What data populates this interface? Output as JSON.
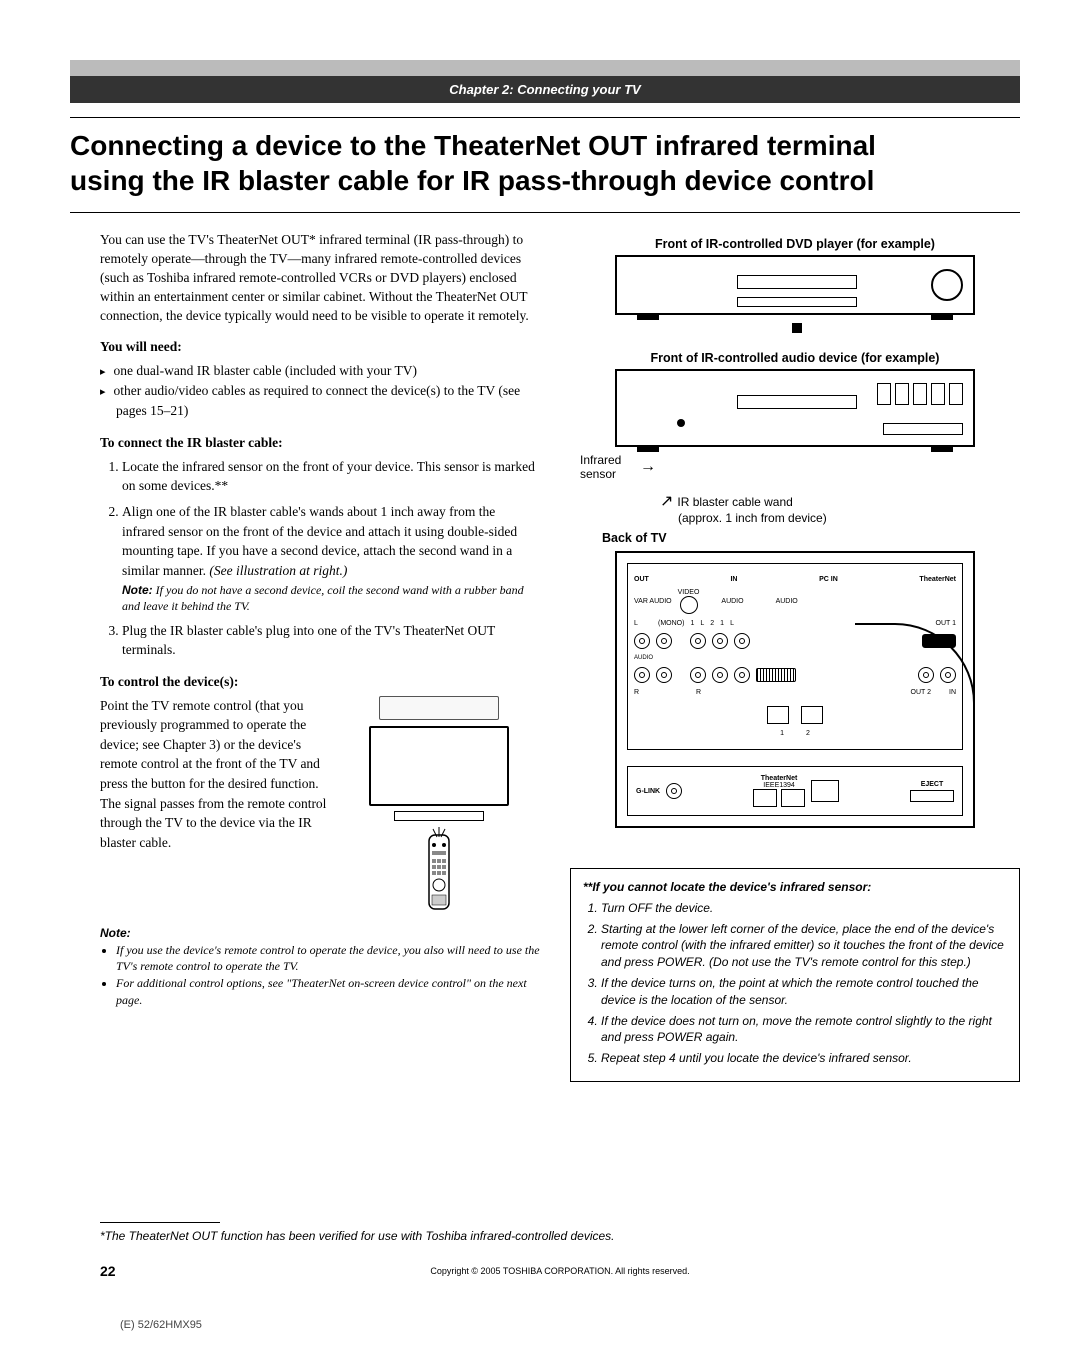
{
  "header": {
    "chapter": "Chapter 2: Connecting your TV"
  },
  "title": {
    "line1": "Connecting a device to the TheaterNet OUT infrared terminal",
    "line2": "using the IR blaster cable for IR pass-through device control"
  },
  "left": {
    "intro": "You can use the TV's TheaterNet OUT* infrared terminal (IR pass-through) to remotely operate—through the TV—many infrared remote-controlled devices (such as Toshiba infrared remote-controlled VCRs or DVD players) enclosed within an entertainment center or similar cabinet. Without the TheaterNet OUT connection, the device typically would need to be visible to operate it remotely.",
    "need_heading": "You will need:",
    "need_items": [
      "one dual-wand IR blaster cable (included with your TV)",
      "other audio/video cables as required to connect the device(s) to the TV (see pages 15–21)"
    ],
    "connect_heading": "To connect the IR blaster cable:",
    "connect_steps": [
      "Locate the infrared sensor on the front of your device. This sensor is marked on some devices.**",
      "Align one of the IR blaster cable's wands about 1 inch away from the infrared sensor on the front of the device and attach it using double-sided mounting tape. If you have a second device, attach the second wand in a similar manner. ",
      "Plug the IR blaster cable's plug into one of the TV's TheaterNet OUT terminals."
    ],
    "see_illus": "(See illustration at right.)",
    "step2_note_label": "Note:",
    "step2_note": " If you do not have a second device, coil the second wand with a rubber band and leave it behind the TV.",
    "control_heading": "To control the device(s):",
    "control_text": "Point the TV remote control (that you previously programmed to operate the device; see Chapter 3) or the device's remote control at the front of the TV and press the button for the desired function. The signal passes from the remote control through the TV to the device via the IR blaster cable.",
    "noteblock_label": "Note:",
    "noteblock_items": [
      "If you use the device's remote control to operate the device, you also will need to use the TV's remote control to operate the TV.",
      "For additional control options, see \"TheaterNet on-screen device control\" on the next page."
    ]
  },
  "right": {
    "fig_dvd": "Front of IR-controlled DVD player (for example)",
    "fig_audio": "Front of IR-controlled audio device (for example)",
    "infrared_label": "Infrared sensor",
    "wand_label1": "IR blaster cable wand",
    "wand_label2": "(approx. 1 inch from device)",
    "back_tv": "Back of TV",
    "panel_labels": {
      "out": "OUT",
      "in": "IN",
      "pcin": "PC IN",
      "theaternet": "TheaterNet",
      "var_audio": "VAR AUDIO",
      "video": "VIDEO",
      "audio": "AUDIO",
      "l": "L",
      "r": "R",
      "mono": "(MONO)",
      "n1": "1",
      "n2": "2",
      "out1": "OUT 1",
      "out2": "OUT 2",
      "in_small": "IN",
      "glink": "G-LINK",
      "ieee": "IEEE1394",
      "tnport": "TheaterNet",
      "eject": "EJECT"
    },
    "sensor": {
      "heading": "**If you cannot locate the device's infrared sensor:",
      "steps": [
        "Turn OFF the device.",
        "Starting at the lower left corner of the device, place the end of the device's remote control (with the infrared emitter) so it touches the front of the device and press POWER. (Do not use the TV's remote control for this step.)",
        "If the device turns on, the point at which the remote control touched the device is the location of the sensor.",
        "If the device does not turn on, move the remote control slightly to the right and press POWER again.",
        "Repeat step 4 until you locate the device's infrared sensor."
      ]
    }
  },
  "footnote": "*The TheaterNet OUT function has been verified for use with Toshiba infrared-controlled devices.",
  "bottom": {
    "page": "22",
    "copyright": "Copyright © 2005 TOSHIBA CORPORATION. All rights reserved."
  },
  "cropline": "(E) 52/62HMX95"
}
